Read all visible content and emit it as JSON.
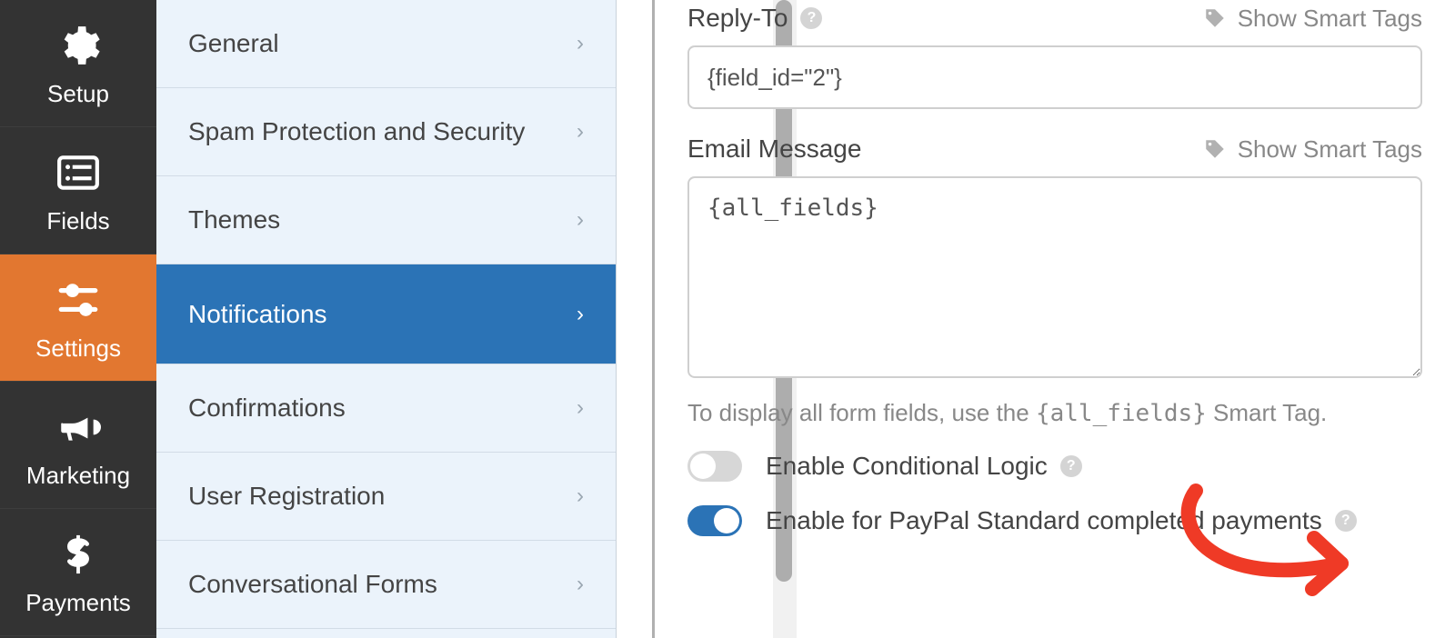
{
  "sidebar_primary": [
    {
      "label": "Setup",
      "icon": "gear"
    },
    {
      "label": "Fields",
      "icon": "list"
    },
    {
      "label": "Settings",
      "icon": "sliders",
      "active": true
    },
    {
      "label": "Marketing",
      "icon": "bullhorn"
    },
    {
      "label": "Payments",
      "icon": "dollar"
    }
  ],
  "sidebar_secondary": [
    {
      "label": "General"
    },
    {
      "label": "Spam Protection and Security"
    },
    {
      "label": "Themes"
    },
    {
      "label": "Notifications",
      "active": true
    },
    {
      "label": "Confirmations"
    },
    {
      "label": "User Registration"
    },
    {
      "label": "Conversational Forms"
    }
  ],
  "main": {
    "reply_to_label": "Reply-To",
    "reply_to_value": "{field_id=\"2\"}",
    "email_message_label": "Email Message",
    "email_message_value": "{all_fields}",
    "smart_tags_label": "Show Smart Tags",
    "hint_prefix": "To display all form fields, use the ",
    "hint_code": "{all_fields}",
    "hint_suffix": " Smart Tag.",
    "toggle_conditional_label": "Enable Conditional Logic",
    "toggle_paypal_label": "Enable for PayPal Standard completed payments"
  }
}
